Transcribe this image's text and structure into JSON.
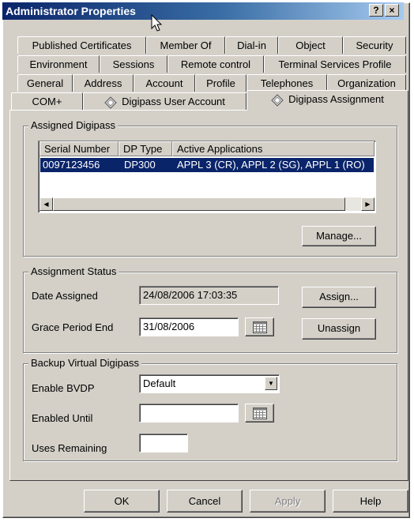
{
  "window": {
    "title": "Administrator Properties",
    "help_button": "?",
    "close_button": "×"
  },
  "tabs": {
    "row1": [
      "Published Certificates",
      "Member Of",
      "Dial-in",
      "Object",
      "Security"
    ],
    "row2": [
      "Environment",
      "Sessions",
      "Remote control",
      "Terminal Services Profile"
    ],
    "row3": [
      "General",
      "Address",
      "Account",
      "Profile",
      "Telephones",
      "Organization"
    ],
    "row4": [
      "COM+",
      "Digipass User Account",
      "Digipass Assignment"
    ],
    "active": "Digipass Assignment"
  },
  "assigned_digipass": {
    "title": "Assigned Digipass",
    "columns": [
      "Serial Number",
      "DP Type",
      "Active Applications"
    ],
    "rows": [
      {
        "serial": "0097123456",
        "type": "DP300",
        "apps": "APPL 3 (CR), APPL 2 (SG), APPL 1 (RO)"
      }
    ],
    "manage_label": "Manage..."
  },
  "assignment_status": {
    "title": "Assignment Status",
    "date_assigned_label": "Date Assigned",
    "date_assigned_value": "24/08/2006 17:03:35",
    "grace_label": "Grace Period End",
    "grace_value": "31/08/2006",
    "assign_label": "Assign...",
    "unassign_label": "Unassign"
  },
  "bvdp": {
    "title": "Backup Virtual Digipass",
    "enable_label": "Enable BVDP",
    "enable_value": "Default",
    "enabled_until_label": "Enabled Until",
    "enabled_until_value": "",
    "uses_label": "Uses Remaining",
    "uses_value": ""
  },
  "footer": {
    "ok": "OK",
    "cancel": "Cancel",
    "apply": "Apply",
    "help": "Help"
  },
  "colors": {
    "titlebar_start": "#0a246a",
    "titlebar_end": "#a6caf0",
    "selection": "#0a246a",
    "face": "#d4d0c8"
  }
}
